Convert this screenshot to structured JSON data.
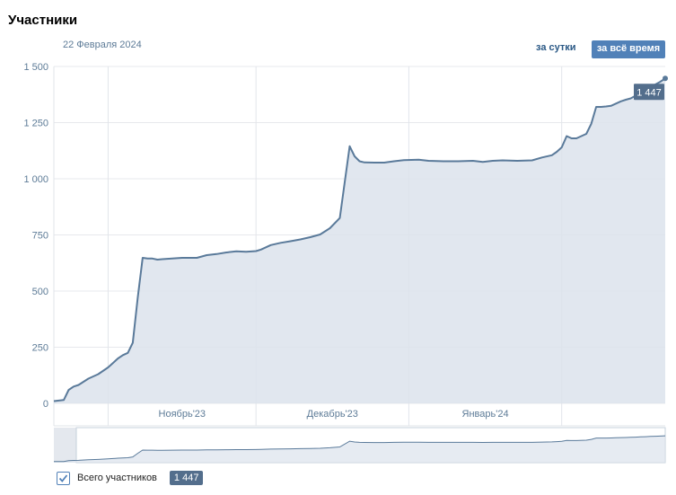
{
  "header": {
    "title": "Участники",
    "date": "22 Февраля 2024",
    "period_day_label": "за сутки",
    "period_all_label": "за всё время"
  },
  "legend": {
    "label": "Всего участников",
    "value": "1 447",
    "checked": true
  },
  "colors": {
    "line": "#5a7a9a",
    "fill": "#dce3ec",
    "accent": "#5181b8",
    "badge": "#536e8c"
  },
  "chart_data": {
    "type": "area",
    "title": "",
    "xlabel": "",
    "ylabel": "",
    "ylim": [
      0,
      1500
    ],
    "yticks": [
      {
        "value": 0,
        "label": "0"
      },
      {
        "value": 250,
        "label": "250"
      },
      {
        "value": 500,
        "label": "500"
      },
      {
        "value": 750,
        "label": "750"
      },
      {
        "value": 1000,
        "label": "1 000"
      },
      {
        "value": 1250,
        "label": "1 250"
      },
      {
        "value": 1500,
        "label": "1 500"
      }
    ],
    "xlim": [
      "2023-10-21",
      "2024-02-22"
    ],
    "xticks": [
      {
        "date": "2023-11-01",
        "label": "Ноябрь'23"
      },
      {
        "date": "2023-12-01",
        "label": "Декабрь'23"
      },
      {
        "date": "2024-01-01",
        "label": "Январь'24"
      }
    ],
    "month_boundaries": [
      "2023-10-21",
      "2023-11-01",
      "2023-12-01",
      "2024-01-01",
      "2024-02-01"
    ],
    "last_value_label": "1 447",
    "series": [
      {
        "name": "Всего участников",
        "points": [
          [
            "2023-10-21",
            10
          ],
          [
            "2023-10-23",
            15
          ],
          [
            "2023-10-24",
            60
          ],
          [
            "2023-10-25",
            75
          ],
          [
            "2023-10-26",
            82
          ],
          [
            "2023-10-28",
            110
          ],
          [
            "2023-10-30",
            130
          ],
          [
            "2023-11-01",
            160
          ],
          [
            "2023-11-03",
            200
          ],
          [
            "2023-11-04",
            215
          ],
          [
            "2023-11-05",
            225
          ],
          [
            "2023-11-06",
            270
          ],
          [
            "2023-11-07",
            470
          ],
          [
            "2023-11-08",
            648
          ],
          [
            "2023-11-09",
            645
          ],
          [
            "2023-11-10",
            645
          ],
          [
            "2023-11-11",
            640
          ],
          [
            "2023-11-12",
            642
          ],
          [
            "2023-11-14",
            645
          ],
          [
            "2023-11-16",
            648
          ],
          [
            "2023-11-18",
            648
          ],
          [
            "2023-11-19",
            648
          ],
          [
            "2023-11-21",
            660
          ],
          [
            "2023-11-23",
            665
          ],
          [
            "2023-11-25",
            672
          ],
          [
            "2023-11-27",
            677
          ],
          [
            "2023-11-29",
            675
          ],
          [
            "2023-12-01",
            678
          ],
          [
            "2023-12-02",
            685
          ],
          [
            "2023-12-04",
            705
          ],
          [
            "2023-12-06",
            715
          ],
          [
            "2023-12-08",
            722
          ],
          [
            "2023-12-10",
            730
          ],
          [
            "2023-12-12",
            740
          ],
          [
            "2023-12-14",
            752
          ],
          [
            "2023-12-16",
            780
          ],
          [
            "2023-12-18",
            825
          ],
          [
            "2023-12-20",
            1145
          ],
          [
            "2023-12-21",
            1100
          ],
          [
            "2023-12-22",
            1078
          ],
          [
            "2023-12-23",
            1073
          ],
          [
            "2023-12-25",
            1072
          ],
          [
            "2023-12-27",
            1072
          ],
          [
            "2023-12-29",
            1078
          ],
          [
            "2023-12-31",
            1083
          ],
          [
            "2024-01-03",
            1085
          ],
          [
            "2024-01-05",
            1080
          ],
          [
            "2024-01-08",
            1078
          ],
          [
            "2024-01-11",
            1078
          ],
          [
            "2024-01-14",
            1080
          ],
          [
            "2024-01-16",
            1075
          ],
          [
            "2024-01-18",
            1080
          ],
          [
            "2024-01-20",
            1082
          ],
          [
            "2024-01-23",
            1080
          ],
          [
            "2024-01-26",
            1082
          ],
          [
            "2024-01-28",
            1095
          ],
          [
            "2024-01-30",
            1105
          ],
          [
            "2024-01-31",
            1120
          ],
          [
            "2024-02-01",
            1140
          ],
          [
            "2024-02-02",
            1190
          ],
          [
            "2024-02-03",
            1180
          ],
          [
            "2024-02-04",
            1180
          ],
          [
            "2024-02-06",
            1200
          ],
          [
            "2024-02-07",
            1245
          ],
          [
            "2024-02-08",
            1320
          ],
          [
            "2024-02-09",
            1320
          ],
          [
            "2024-02-10",
            1322
          ],
          [
            "2024-02-11",
            1325
          ],
          [
            "2024-02-12",
            1335
          ],
          [
            "2024-02-13",
            1345
          ],
          [
            "2024-02-14",
            1352
          ],
          [
            "2024-02-15",
            1358
          ],
          [
            "2024-02-16",
            1370
          ],
          [
            "2024-02-17",
            1385
          ],
          [
            "2024-02-18",
            1395
          ],
          [
            "2024-02-19",
            1410
          ],
          [
            "2024-02-20",
            1420
          ],
          [
            "2024-02-21",
            1432
          ],
          [
            "2024-02-22",
            1447
          ]
        ]
      }
    ]
  }
}
